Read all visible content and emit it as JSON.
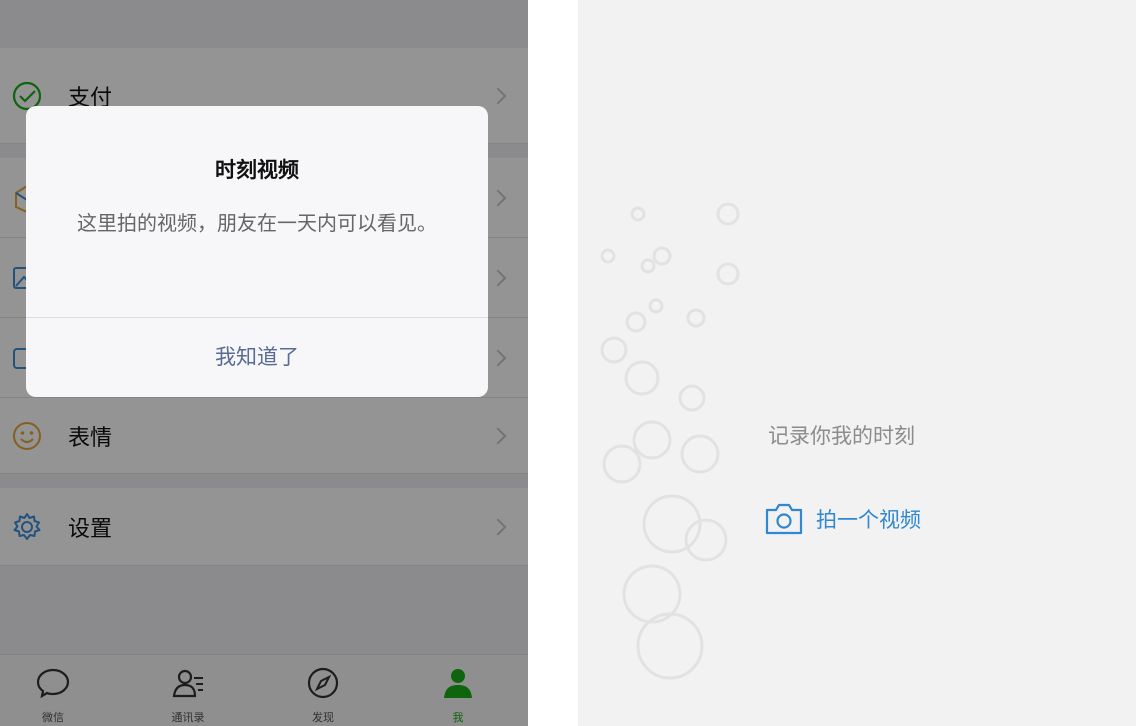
{
  "menu": {
    "items": [
      {
        "label": "支付",
        "icon": "wechat-pay-icon"
      },
      {
        "label": "",
        "icon": "favorites-icon"
      },
      {
        "label": "",
        "icon": "album-icon"
      },
      {
        "label": "",
        "icon": "cards-icon"
      },
      {
        "label": "表情",
        "icon": "sticker-icon"
      },
      {
        "label": "设置",
        "icon": "settings-gear-icon"
      }
    ]
  },
  "tabbar": {
    "tabs": [
      {
        "label": "微信",
        "icon": "chat-bubble-icon",
        "active": false
      },
      {
        "label": "通讯录",
        "icon": "contacts-icon",
        "active": false
      },
      {
        "label": "发现",
        "icon": "compass-icon",
        "active": false
      },
      {
        "label": "我",
        "icon": "person-icon",
        "active": true
      }
    ]
  },
  "dialog": {
    "title": "时刻视频",
    "message": "这里拍的视频，朋友在一天内可以看见。",
    "confirm_label": "我知道了"
  },
  "moments_panel": {
    "caption": "记录你我的时刻",
    "shoot_label": "拍一个视频",
    "shoot_icon": "camera-icon"
  },
  "colors": {
    "wechat_green": "#1aad19",
    "link_blue": "#576b95",
    "shoot_blue": "#2f88d0"
  }
}
